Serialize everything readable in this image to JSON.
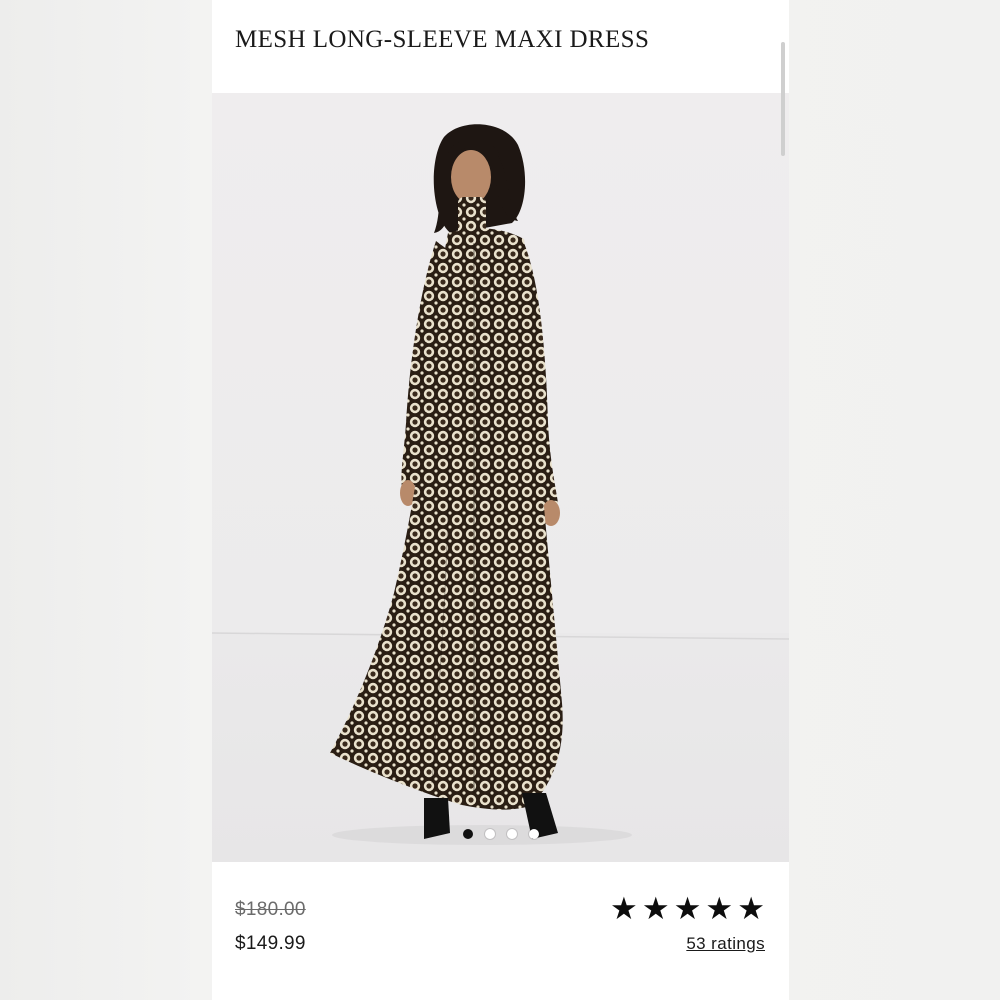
{
  "product": {
    "title": "MESH LONG-SLEEVE MAXI DRESS",
    "image_alt": "Model wearing a mesh long-sleeve maxi dress with a black and cream circle print",
    "gallery": {
      "image_count": 4,
      "active_index": 0
    },
    "price": {
      "original": "$180.00",
      "sale": "$149.99"
    },
    "rating": {
      "stars": 5,
      "max_stars": 5,
      "ratings_label": "53 ratings"
    }
  },
  "colors": {
    "page_background": "#f1f1f0",
    "photo_background": "#efedee",
    "text": "#1a1a1a",
    "strike_price": "#6b6b6b",
    "active_dot": "#111111"
  }
}
